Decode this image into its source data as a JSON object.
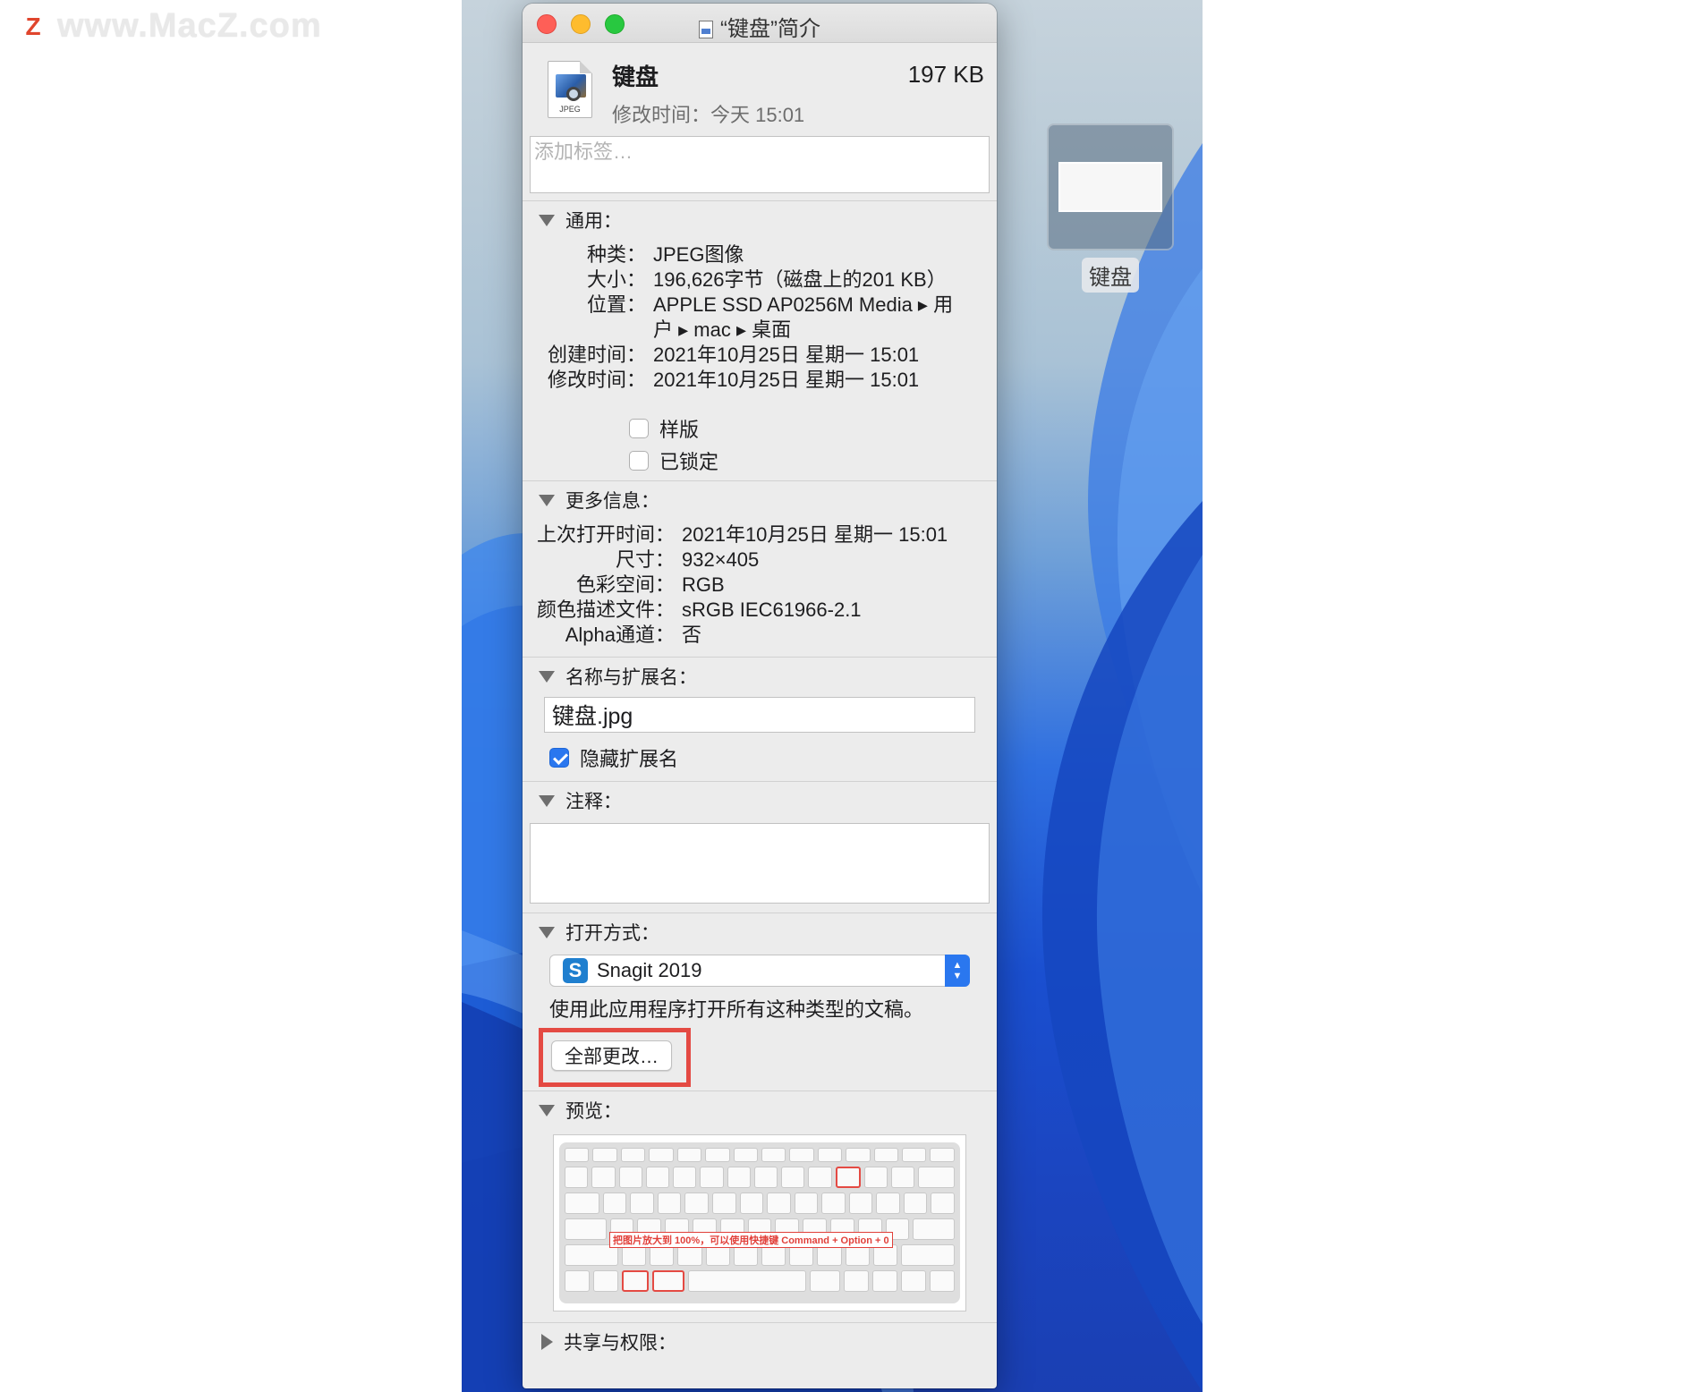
{
  "watermark": {
    "logo": "Z",
    "text": "www.MacZ.com"
  },
  "desktop": {
    "file_label": "键盘"
  },
  "window": {
    "title": "“键盘”简介",
    "file_name": "键盘",
    "file_size": "197 KB",
    "file_type_badge": "JPEG",
    "modified_line": "修改时间：今天 15:01",
    "tags_placeholder": "添加标签…"
  },
  "general": {
    "header": "通用：",
    "rows": [
      {
        "k": "种类：",
        "v": "JPEG图像"
      },
      {
        "k": "大小：",
        "v": "196,626字节（磁盘上的201 KB）"
      },
      {
        "k": "位置：",
        "v": "APPLE SSD AP0256M Media ▸ 用"
      },
      {
        "k": "",
        "v": "户 ▸ mac ▸ 桌面"
      },
      {
        "k": "创建时间：",
        "v": "2021年10月25日 星期一 15:01"
      },
      {
        "k": "修改时间：",
        "v": "2021年10月25日 星期一 15:01"
      }
    ],
    "stationery_label": "样版",
    "locked_label": "已锁定"
  },
  "more_info": {
    "header": "更多信息：",
    "rows": [
      {
        "k": "上次打开时间：",
        "v": "2021年10月25日 星期一 15:01"
      },
      {
        "k": "尺寸：",
        "v": "932×405"
      },
      {
        "k": "色彩空间：",
        "v": "RGB"
      },
      {
        "k": "颜色描述文件：",
        "v": "sRGB IEC61966-2.1"
      },
      {
        "k": "Alpha通道：",
        "v": "否"
      }
    ]
  },
  "name_ext": {
    "header": "名称与扩展名：",
    "value": "键盘.jpg",
    "hide_ext_label": "隐藏扩展名",
    "hide_ext_checked": true
  },
  "comments": {
    "header": "注释："
  },
  "open_with": {
    "header": "打开方式：",
    "app_icon_letter": "S",
    "app": "Snagit 2019",
    "usage": "使用此应用程序打开所有这种类型的文稿。",
    "change_all_button": "全部更改…",
    "highlight_color": "#e44a43"
  },
  "preview": {
    "header": "预览：",
    "note": "把图片放大到 100%，可以使用快捷键 Command + Option + 0"
  },
  "sharing": {
    "header": "共享与权限："
  }
}
